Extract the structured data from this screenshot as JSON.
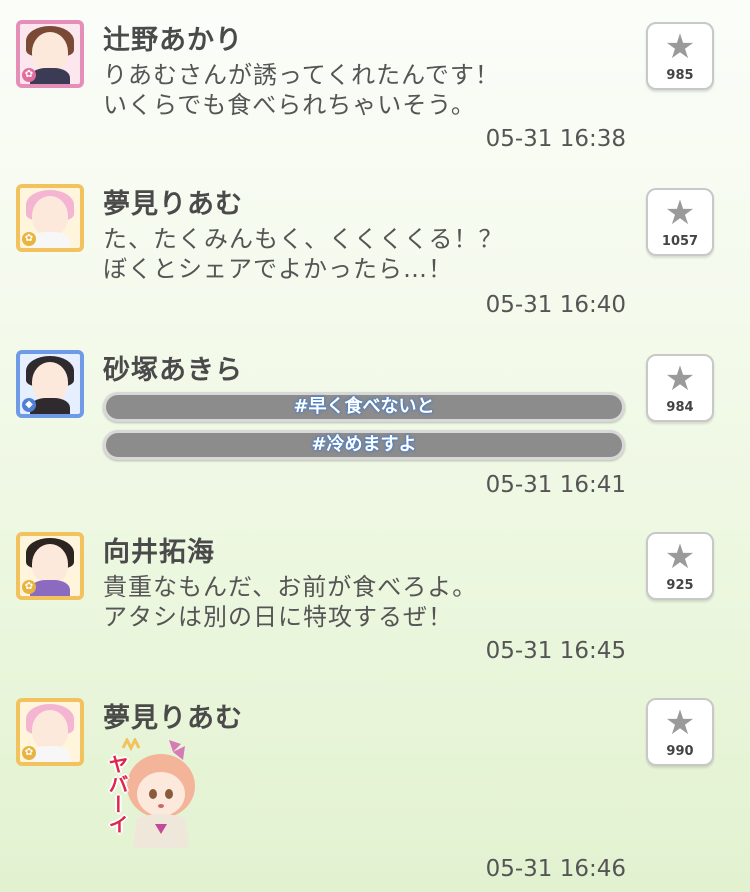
{
  "posts": [
    {
      "name": "辻野あかり",
      "lines": [
        "りあむさんが誘ってくれたんです！",
        "いくらでも食べられちゃいそう。"
      ],
      "time": "05-31 16:38",
      "fav_count": "985",
      "frame_color": "#e58fb8",
      "badge": "✿"
    },
    {
      "name": "夢見りあむ",
      "lines": [
        "た、たくみんもく、くくくくる！？",
        "ぼくとシェアでよかったら…！"
      ],
      "time": "05-31 16:40",
      "fav_count": "1057",
      "frame_color": "#f2c25e",
      "badge": "✿"
    },
    {
      "name": "砂塚あきら",
      "tags": [
        "#早く食べないと",
        "#冷めますよ"
      ],
      "time": "05-31 16:41",
      "fav_count": "984",
      "frame_color": "#6f9be6",
      "badge": "◆"
    },
    {
      "name": "向井拓海",
      "lines": [
        "貴重なもんだ、お前が食べろよ。",
        "アタシは別の日に特攻するぜ！"
      ],
      "time": "05-31 16:45",
      "fav_count": "925",
      "frame_color": "#f2c25e",
      "badge": "✿"
    },
    {
      "name": "夢見りあむ",
      "sticker_text": "ヤバーイ",
      "time": "05-31 16:46",
      "fav_count": "990",
      "frame_color": "#f2c25e",
      "badge": "✿"
    }
  ],
  "icons": {
    "favorite": "star-icon"
  },
  "colors": {
    "tag_bg": "#8c8c8c",
    "tag_glow": "#3a7bd5",
    "star": "#9a9a9a"
  }
}
